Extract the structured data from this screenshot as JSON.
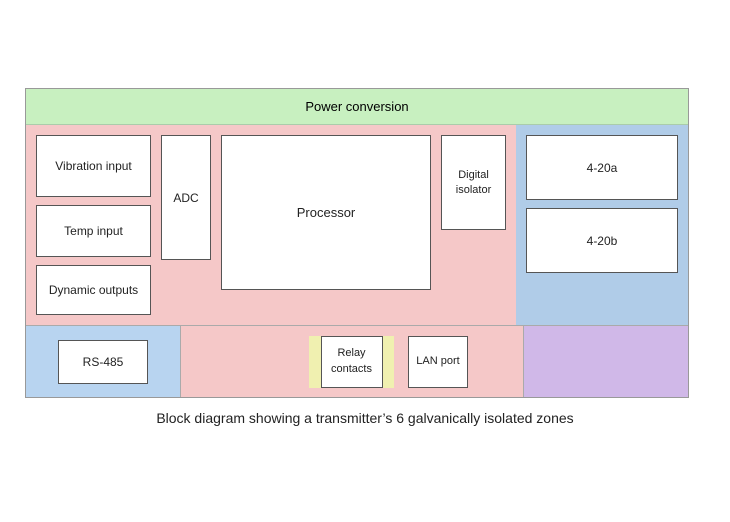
{
  "diagram": {
    "title": "Block diagram showing a transmitter’s 6 galvanically isolated zones",
    "power_conversion": "Power conversion",
    "blocks": {
      "vibration_input": "Vibration input",
      "temp_input": "Temp input",
      "dynamic_outputs": "Dynamic outputs",
      "adc": "ADC",
      "processor": "Processor",
      "digital_isolator": "Digital isolator",
      "output_a": "4-20a",
      "output_b": "4-20b",
      "rs485": "RS-485",
      "relay_contacts": "Relay contacts",
      "lan_port": "LAN port"
    }
  }
}
